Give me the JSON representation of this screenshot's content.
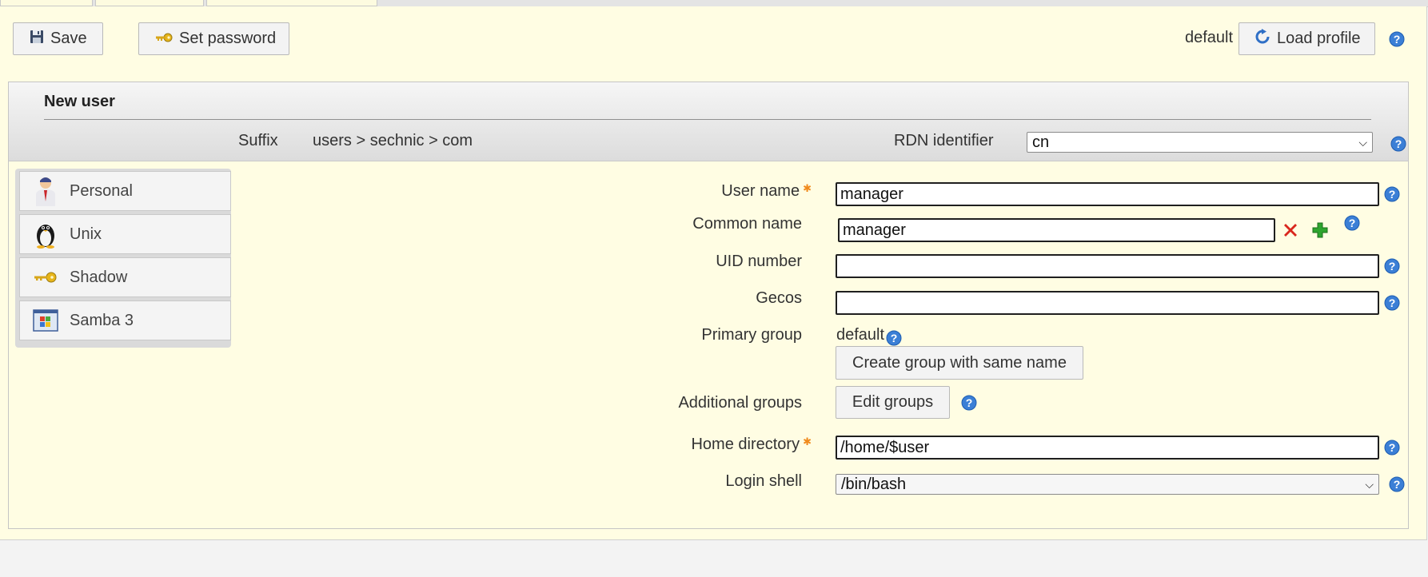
{
  "toolbar": {
    "save_label": "Save",
    "set_password_label": "Set password",
    "profile_name": "default",
    "load_profile_label": "Load profile"
  },
  "panel": {
    "title": "New user",
    "suffix_label": "Suffix",
    "suffix_value": "users > sechnic > com",
    "rdn_label": "RDN identifier",
    "rdn_value": "cn"
  },
  "sidebar": {
    "items": [
      {
        "label": "Personal",
        "icon": "person-icon"
      },
      {
        "label": "Unix",
        "icon": "penguin-icon"
      },
      {
        "label": "Shadow",
        "icon": "key-icon"
      },
      {
        "label": "Samba 3",
        "icon": "windows-icon"
      }
    ]
  },
  "form": {
    "user_name_label": "User name",
    "user_name_value": "manager",
    "common_name_label": "Common name",
    "common_name_value": "manager",
    "uid_label": "UID number",
    "uid_value": "",
    "gecos_label": "Gecos",
    "gecos_value": "",
    "primary_group_label": "Primary group",
    "primary_group_value": "default",
    "create_group_label": "Create group with same name",
    "additional_groups_label": "Additional groups",
    "edit_groups_label": "Edit groups",
    "home_label": "Home directory",
    "home_value": "/home/$user",
    "login_shell_label": "Login shell",
    "login_shell_value": "/bin/bash"
  },
  "colors": {
    "background": "#fffde3",
    "help_icon": "#3b7fd6",
    "required_mark": "#f08a1c",
    "remove_icon": "#d9271d",
    "add_icon": "#2ea42e"
  }
}
